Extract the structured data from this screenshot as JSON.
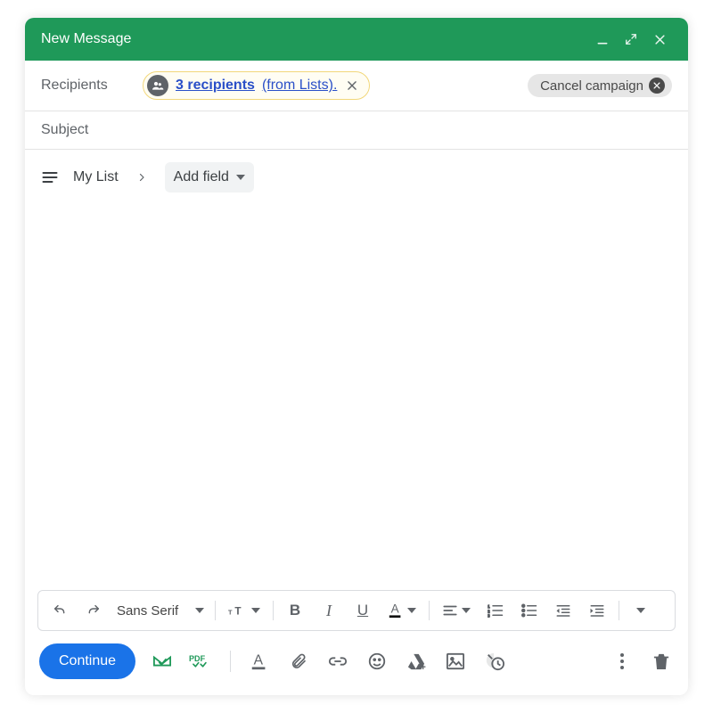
{
  "window": {
    "title": "New Message"
  },
  "recipients": {
    "label": "Recipients",
    "chip_main": "3 recipients",
    "chip_suffix": "(from Lists)."
  },
  "cancel_campaign": {
    "label": "Cancel campaign"
  },
  "subject": {
    "placeholder": "Subject"
  },
  "listbar": {
    "name": "My List",
    "add_field": "Add field"
  },
  "format_toolbar": {
    "font": "Sans Serif"
  },
  "bottom": {
    "continue": "Continue"
  },
  "icons": {
    "bold": "B",
    "italic": "I",
    "underline": "U"
  }
}
